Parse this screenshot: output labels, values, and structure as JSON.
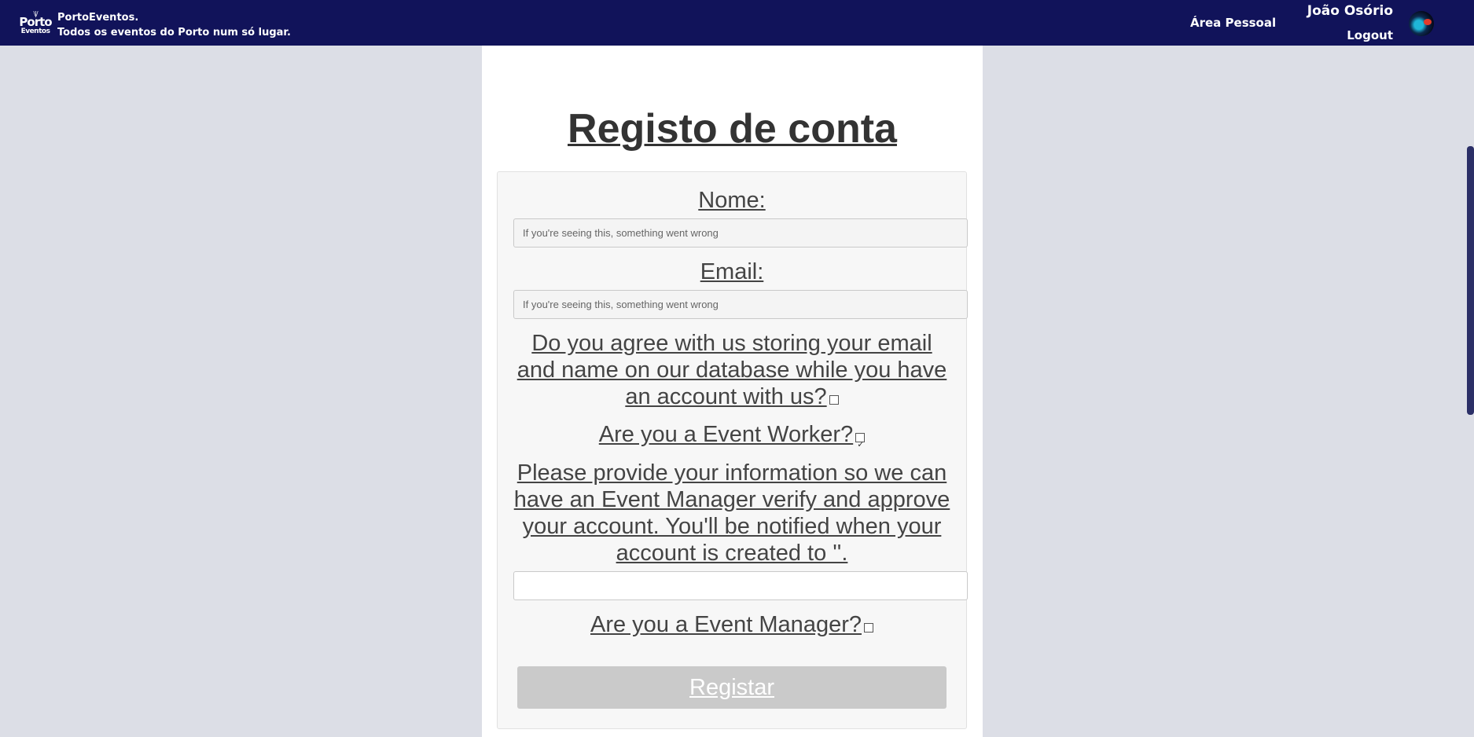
{
  "header": {
    "logo_top": "Porto",
    "logo_bottom": "Eventos",
    "brand_line1": "PortoEventos.",
    "brand_line2": "Todos os eventos do Porto num só lugar.",
    "nav_personal": "Área Pessoal",
    "user_name": "João Osório",
    "logout": "Logout"
  },
  "form": {
    "title": "Registo de conta",
    "name_label": "Nome:",
    "name_placeholder": "If you're seeing this, something went wrong",
    "email_label": "Email:",
    "email_placeholder": "If you're seeing this, something went wrong",
    "consent_text": "Do you agree with us storing your email and name on our database while you have an account with us?",
    "consent_checked": false,
    "worker_text": "Are you a Event Worker?",
    "worker_checked": true,
    "worker_info_text": "Please provide your information so we can have an Event Manager verify and approve your account. You'll be notified when your account is created to ''.",
    "worker_info_value": "",
    "manager_text": "Are you a Event Manager?",
    "manager_checked": false,
    "submit_label": "Registar"
  }
}
